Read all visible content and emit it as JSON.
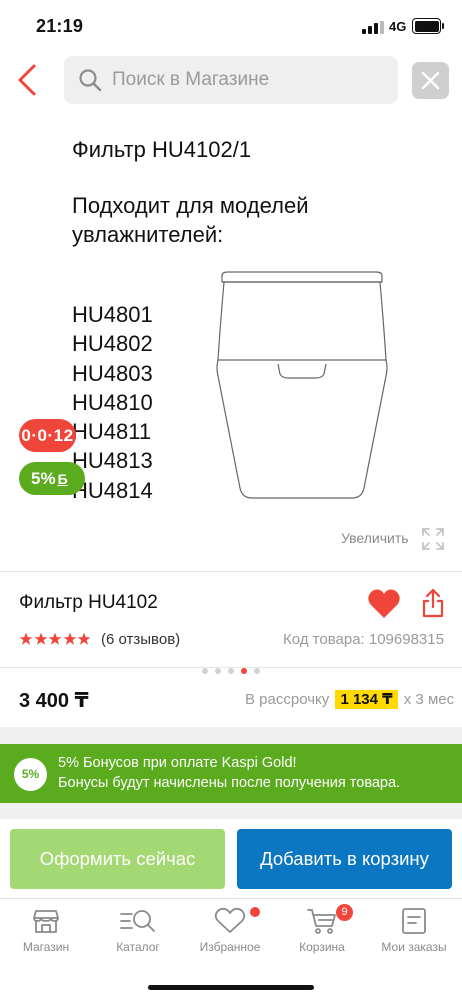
{
  "status_bar": {
    "time": "21:19",
    "network": "4G"
  },
  "search": {
    "placeholder": "Поиск в Магазине",
    "value": ""
  },
  "product_image": {
    "title_line": "Фильтр HU4102/1",
    "subtitle_line1": "Подходит для моделей",
    "subtitle_line2": "увлажнителей:",
    "models": [
      "HU4801",
      "HU4802",
      "HU4803",
      "HU4810",
      "HU4811",
      "HU4813",
      "HU4814"
    ],
    "badge_timer": "0·0·12",
    "badge_bonus_percent": "5%",
    "badge_bonus_currency": "Б",
    "zoom_label": "Увеличить",
    "gallery": {
      "total": 5,
      "active_index": 3
    }
  },
  "product": {
    "title": "Фильтр HU4102",
    "rating": 5,
    "reviews": "(6 отзывов)",
    "code": "Код товара: 109698315",
    "price": "3 400 ₸",
    "installment_prefix": "В рассрочку",
    "installment_amount": "1 134 ₸",
    "installment_suffix": "х 3 мес"
  },
  "bonus_banner": {
    "badge": "5%",
    "line1": "5% Бонусов при оплате Kaspi Gold!",
    "line2": "Бонусы будут начислены после получения товара."
  },
  "actions": {
    "buy_now": "Оформить сейчас",
    "add_to_cart": "Добавить в корзину"
  },
  "tabbar": {
    "items": [
      {
        "label": "Магазин",
        "icon": "shop-icon"
      },
      {
        "label": "Каталог",
        "icon": "catalog-search-icon"
      },
      {
        "label": "Избранное",
        "icon": "heart-icon"
      },
      {
        "label": "Корзина",
        "icon": "cart-icon"
      },
      {
        "label": "Мои заказы",
        "icon": "orders-icon"
      }
    ],
    "cart_count": "9"
  },
  "colors": {
    "accent_red": "#f0453a",
    "kaspi_green": "#5bab1e",
    "buy_button": "#a4d872",
    "cart_button": "#0b76c1",
    "installment_highlight": "#ffd900"
  }
}
